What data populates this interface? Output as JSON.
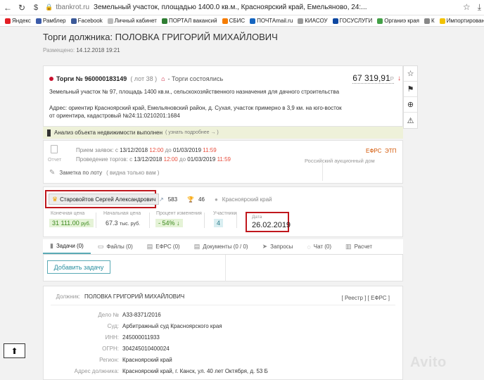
{
  "browser": {
    "domain": "tbankrot.ru",
    "tab_title": "Земельный участок, площадью 1400.0 кв.м., Красноярский край, Емельяново, 24:..."
  },
  "bookmarks": [
    {
      "label": "Яндекс",
      "color": "#e31e24"
    },
    {
      "label": "Рамблер",
      "color": "#3b5ba9"
    },
    {
      "label": "Facebook",
      "color": "#3b5998"
    },
    {
      "label": "Личный кабинет",
      "color": "#bbbbbb"
    },
    {
      "label": "ПОРТАЛ вакансий",
      "color": "#2e7d32"
    },
    {
      "label": "СБИС",
      "color": "#f57c00"
    },
    {
      "label": "ПОЧТАmail.ru",
      "color": "#1565c0"
    },
    {
      "label": "КИАСОУ",
      "color": "#999999"
    },
    {
      "label": "ГОСУСЛУГИ",
      "color": "#0d47a1"
    },
    {
      "label": "Органиэ края",
      "color": "#43a047"
    },
    {
      "label": "К",
      "color": "#888888"
    },
    {
      "label": "Импортировано",
      "color": "#f2c200"
    }
  ],
  "page": {
    "title": "Торги должника: ПОЛОВКА ГРИГОРИЙ МИХАЙЛОВИЧ",
    "posted_label": "Размещено:",
    "posted_date": "14.12.2018 19:21"
  },
  "lot": {
    "number": "Торги № 960000183149",
    "lot_no": "( лот 38 )",
    "status": "- Торги состоялись",
    "price": "67 319,91",
    "currency": "Р",
    "description": "Земельный участок № 97, площадь 1400 кв.м., сельскохозяйственного назначения для дачного строительства",
    "address": "Адрес: ориентир Красноярский край, Емельяновский район, д. Сухая, участок примерно в 3,9 км. на юго-восток от ориентира, кадастровый №24:11:0210201:1684"
  },
  "side_icons": [
    "star-icon",
    "bookmark-icon",
    "target-icon",
    "warning-icon"
  ],
  "analysis": {
    "text": "Анализ объекта недвижимости выполнен",
    "more": "( узнать подробнее → )"
  },
  "dates": {
    "report_label": "Отчет",
    "line1_label": "Прием заявок:",
    "line1_from_pre": "с",
    "line1_from": "13/12/2018",
    "line1_from_time": "12:00",
    "line1_to_pre": "до",
    "line1_to": "01/03/2019",
    "line1_to_time": "11:59",
    "line2_label": "Проведение торгов:",
    "line2_from_pre": "с",
    "line2_from": "13/12/2018",
    "line2_from_time": "12:00",
    "line2_to_pre": "до",
    "line2_to": "01/03/2019",
    "line2_to_time": "11:59",
    "efrs": "ЕФРС",
    "etp": "ЭТП",
    "platform": "Российский аукционный дом",
    "note": "Заметка по лоту",
    "note_hint": "( видна только вам )"
  },
  "winner": {
    "name": "Старовойтов Сергей Александрович",
    "views": "583",
    "wins": "46",
    "region": "Красноярский край"
  },
  "stats": {
    "final_price_label": "Конечная цена",
    "final_price": "31 111.00",
    "final_price_unit": "руб.",
    "start_price_label": "Начальная цена",
    "start_price": "67.3",
    "start_price_unit": "тыс. руб.",
    "change_label": "Процент изменения",
    "change": "- 54%",
    "participants_label": "Участники",
    "participants": "4",
    "date_label": "Дата",
    "date": "26.02.2019"
  },
  "tabs": [
    {
      "label": "Задачи (0)",
      "icon": "book-icon"
    },
    {
      "label": "Файлы (0)",
      "icon": "folder-icon"
    },
    {
      "label": "ЕФРС (0)",
      "icon": "doc-icon"
    },
    {
      "label": "Документы (0 / 0)",
      "icon": "document-icon"
    },
    {
      "label": "Запросы",
      "icon": "send-icon"
    },
    {
      "label": "Чат (0)",
      "icon": "chat-icon"
    },
    {
      "label": "Расчет",
      "icon": "chart-icon"
    }
  ],
  "tasks": {
    "add_button": "Добавить задачу"
  },
  "debtor": {
    "label": "Должник:",
    "name": "ПОЛОВКА ГРИГОРИЙ МИХАЙЛОВИЧ",
    "links": "[ Реестр ]  [ ЕФРС ]",
    "rows": [
      {
        "label": "Дело №",
        "value": "А33-8371/2016"
      },
      {
        "label": "Суд:",
        "value": "Арбитражный суд Красноярского края"
      },
      {
        "label": "ИНН:",
        "value": "245000011933"
      },
      {
        "label": "ОГРН:",
        "value": "304245010400024"
      },
      {
        "label": "Регион:",
        "value": "Красноярский край"
      },
      {
        "label": "Адрес должника:",
        "value": "Красноярский край, г. Канск, ул. 40 лет Октября, д. 53 Б"
      }
    ]
  },
  "watermark": "Avito"
}
